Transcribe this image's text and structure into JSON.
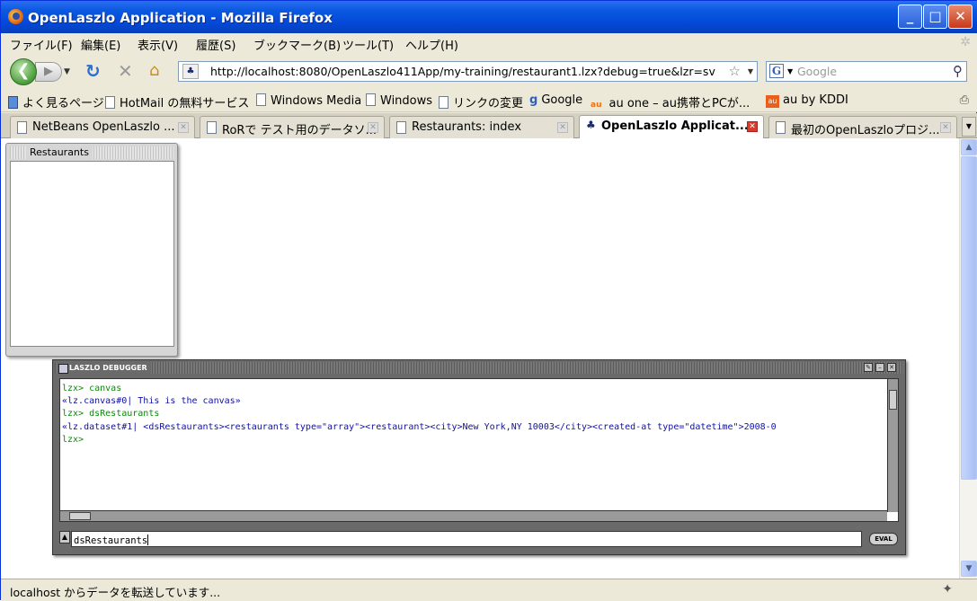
{
  "window": {
    "title": "OpenLaszlo Application - Mozilla Firefox"
  },
  "menu": [
    "ファイル(F)",
    "編集(E)",
    "表示(V)",
    "履歴(S)",
    "ブックマーク(B)",
    "ツール(T)",
    "ヘルプ(H)"
  ],
  "nav": {
    "url": "http://localhost:8080/OpenLaszlo411App/my-training/restaurant1.lzx?debug=true&lzr=sv",
    "search_placeholder": "Google",
    "search_engine": "G"
  },
  "bookmarks": [
    "よく見るページ",
    "HotMail の無料サービス",
    "Windows Media",
    "Windows",
    "リンクの変更",
    "Google",
    "au one – au携帯とPCが...",
    "au by KDDI"
  ],
  "tabs": [
    {
      "label": "NetBeans OpenLaszlo ...",
      "active": false
    },
    {
      "label": "RoRで テスト用のデータソ...",
      "active": false
    },
    {
      "label": "Restaurants: index",
      "active": false
    },
    {
      "label": "OpenLaszlo Applicat...",
      "active": true
    },
    {
      "label": "最初のOpenLaszloプロジ...",
      "active": false
    }
  ],
  "restaurants_window": {
    "title": "Restaurants"
  },
  "debugger": {
    "title": "LASZLO DEBUGGER",
    "lines": [
      {
        "text": "lzx> canvas",
        "kind": "prompt"
      },
      {
        "text": "«lz.canvas#0| This is the canvas»",
        "kind": "result"
      },
      {
        "text": "lzx> dsRestaurants",
        "kind": "prompt"
      },
      {
        "text": "«lz.dataset#1| <dsRestaurants><restaurants type=\"array\"><restaurant><city>New York,NY 10003</city><created-at type=\"datetime\">2008-0",
        "kind": "result"
      },
      {
        "text": "lzx>",
        "kind": "prompt"
      }
    ],
    "input": "dsRestaurants",
    "eval_label": "EVAL"
  },
  "status": {
    "text": "localhost からデータを転送しています..."
  }
}
